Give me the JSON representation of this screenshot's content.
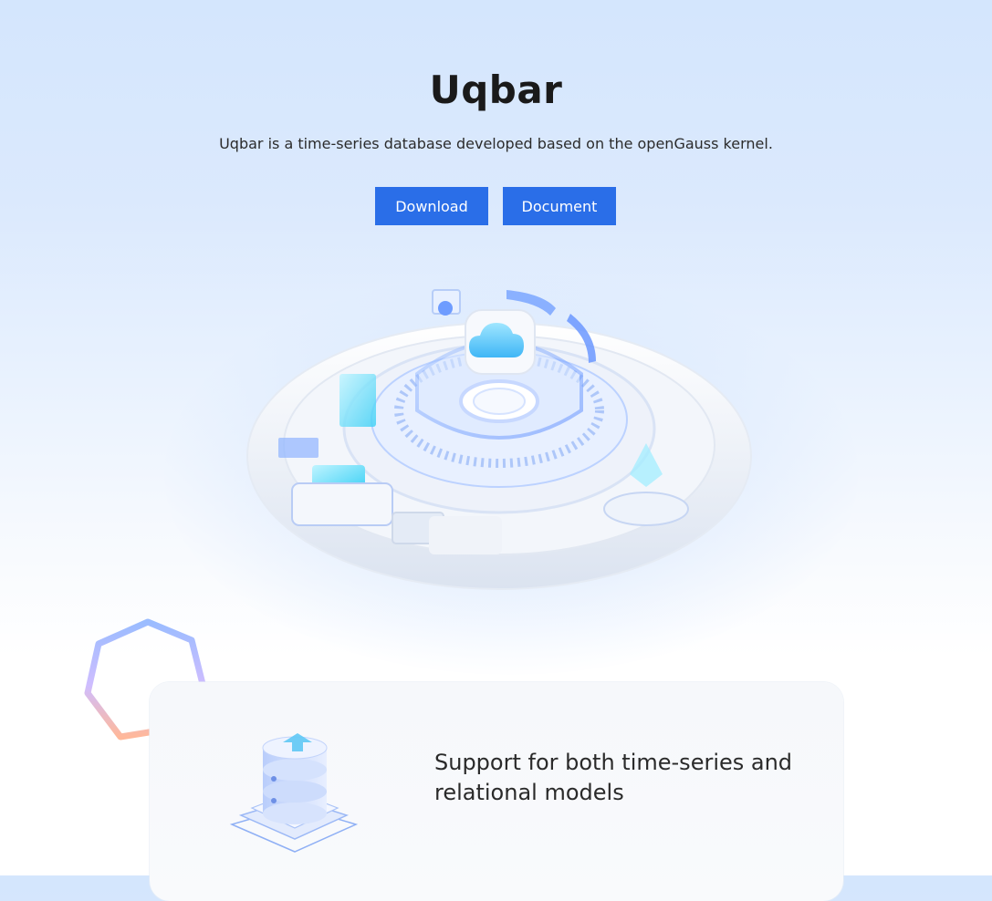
{
  "hero": {
    "title": "Uqbar",
    "subtitle": "Uqbar is a time-series database developed based on the openGauss kernel.",
    "buttons": {
      "download_label": "Download",
      "document_label": "Document"
    }
  },
  "illustration": {
    "subject": "cloud-database-platform-illustration"
  },
  "features": [
    {
      "icon": "database-stack-icon",
      "text": "Support for both time-series and relational models"
    }
  ],
  "colors": {
    "accent": "#2a6ee8",
    "title": "#1a1a1a",
    "background_top": "#d4e6fd"
  }
}
